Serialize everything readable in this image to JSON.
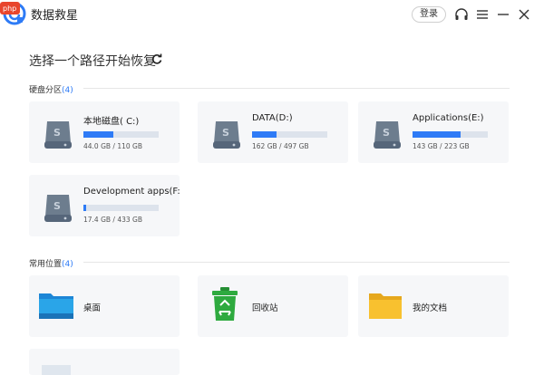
{
  "app": {
    "title": "数据救星",
    "login_label": "登录"
  },
  "main": {
    "title": "选择一个路径开始恢复"
  },
  "drives_section": {
    "label": "硬盘分区",
    "count": "(4)",
    "items": [
      {
        "name": "本地磁盘( C:)",
        "size": "44.0 GB / 110 GB",
        "usage": 0.4
      },
      {
        "name": "DATA(D:)",
        "size": "162 GB / 497 GB",
        "usage": 0.33
      },
      {
        "name": "Applications(E:)",
        "size": "143 GB / 223 GB",
        "usage": 0.64
      },
      {
        "name": "Development apps(F:",
        "size": "17.4 GB / 433 GB",
        "usage": 0.04
      }
    ]
  },
  "locations_section": {
    "label": "常用位置",
    "count": "(4)",
    "items": [
      {
        "name": "桌面",
        "icon": "desktop-folder-icon"
      },
      {
        "name": "回收站",
        "icon": "recycle-bin-icon"
      },
      {
        "name": "我的文档",
        "icon": "documents-folder-icon"
      }
    ]
  },
  "watermark": "php 中文网",
  "colors": {
    "accent": "#2e7bf6",
    "card_bg": "#f6f7f9",
    "drive_gray": "#5f6f80",
    "recycle_green": "#2eaa3f",
    "folder_yellow": "#f8c12f",
    "folder_blue": "#1d86d6"
  }
}
